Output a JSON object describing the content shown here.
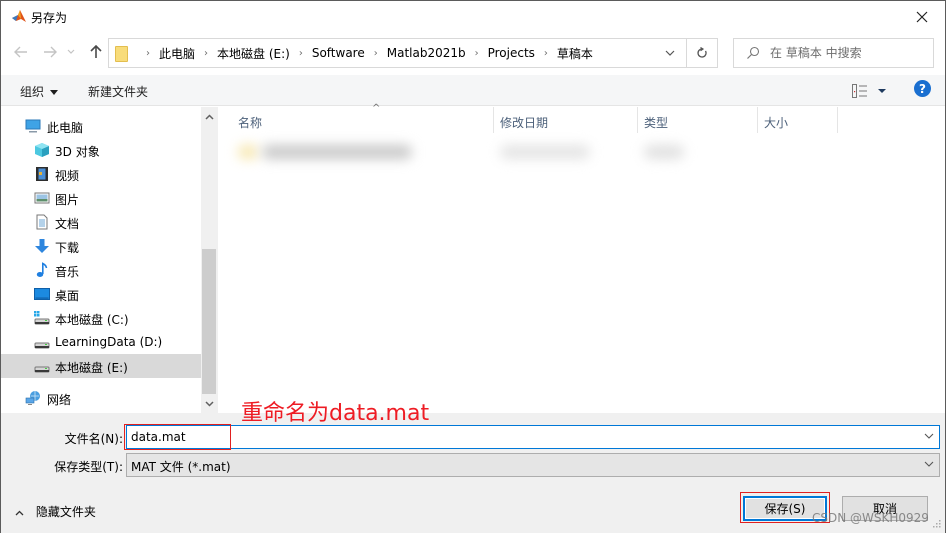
{
  "window": {
    "title": "另存为",
    "close_label": "×"
  },
  "nav": {
    "back_icon": "arrow-left-icon",
    "forward_icon": "arrow-right-icon",
    "recent_icon": "chevron-down-icon",
    "up_icon": "arrow-up-icon",
    "breadcrumb": [
      "此电脑",
      "本地磁盘 (E:)",
      "Software",
      "Matlab2021b",
      "Projects",
      "草稿本"
    ],
    "search_placeholder": "在 草稿本 中搜索"
  },
  "toolbar": {
    "organize_label": "组织",
    "new_folder_label": "新建文件夹",
    "help_label": "?"
  },
  "sidebar": {
    "items": [
      {
        "label": "此电脑",
        "icon": "computer-icon",
        "level": 0,
        "selected": false
      },
      {
        "label": "3D 对象",
        "icon": "cube-3d-icon",
        "level": 1,
        "selected": false
      },
      {
        "label": "视频",
        "icon": "video-icon",
        "level": 1,
        "selected": false
      },
      {
        "label": "图片",
        "icon": "pictures-icon",
        "level": 1,
        "selected": false
      },
      {
        "label": "文档",
        "icon": "documents-icon",
        "level": 1,
        "selected": false
      },
      {
        "label": "下载",
        "icon": "download-icon",
        "level": 1,
        "selected": false
      },
      {
        "label": "音乐",
        "icon": "music-icon",
        "level": 1,
        "selected": false
      },
      {
        "label": "桌面",
        "icon": "desktop-icon",
        "level": 1,
        "selected": false
      },
      {
        "label": "本地磁盘 (C:)",
        "icon": "system-drive-icon",
        "level": 1,
        "selected": false
      },
      {
        "label": "LearningData (D:)",
        "icon": "drive-icon",
        "level": 1,
        "selected": false
      },
      {
        "label": "本地磁盘 (E:)",
        "icon": "drive-icon",
        "level": 1,
        "selected": true
      },
      {
        "label": "网络",
        "icon": "network-icon",
        "level": 0,
        "selected": false
      }
    ]
  },
  "filelist": {
    "columns": [
      "名称",
      "修改日期",
      "类型",
      "大小"
    ],
    "sorted_column": "名称"
  },
  "form": {
    "filename_label": "文件名(N):",
    "filename_value": "data.mat",
    "filetype_label": "保存类型(T):",
    "filetype_value": "MAT 文件 (*.mat)",
    "hide_folders_label": "隐藏文件夹",
    "save_label": "保存(S)",
    "cancel_label": "取消"
  },
  "annotation": {
    "text": "重命名为data.mat",
    "color": "#ee1c24"
  },
  "watermark": "CSDN @WSKH0929",
  "colors": {
    "accent": "#0078d7",
    "help": "#1a6fd0",
    "selected_bg": "#d9d9d9",
    "toolbar_bg": "#f5f6f7",
    "bottom_bg": "#f0f0f0"
  }
}
